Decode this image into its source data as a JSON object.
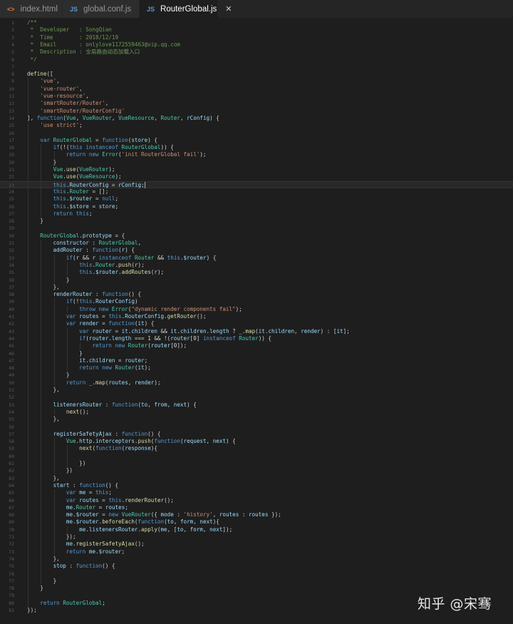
{
  "tabs": [
    {
      "label": "index.html",
      "icon": "html-file-icon",
      "active": false
    },
    {
      "label": "global.conf.js",
      "icon": "js-file-icon",
      "active": false
    },
    {
      "label": "RouterGlobal.js",
      "icon": "js-file-icon",
      "active": true
    }
  ],
  "tab_icons": {
    "html": "<>",
    "js": "JS"
  },
  "close_glyph": "✕",
  "cursor_line": 23,
  "code_lines": [
    "/**",
    " *  Developer   : SongQian",
    " *  Time        : 2018/12/19",
    " *  Email       : onlylove1172559463@vip.qq.com",
    " *  Description : 全局路由动态加载入口",
    " */",
    "",
    "define([",
    "    'vue',",
    "    'vue-router',",
    "    'vue-resource',",
    "    'smartRouter/Router',",
    "    'smartRouter/RouterConfig'",
    "], function(Vue, VueRouter, VueResource, Router, rConfig) {",
    "    'use strict';",
    "",
    "    var RouterGlobal = function(store) {",
    "        if(!(this instanceof RouterGlobal)) {",
    "            return new Error('init RouterGlobal fail');",
    "        }",
    "        Vue.use(VueRouter);",
    "        Vue.use(VueResource);",
    "        this.RouterConfig = rConfig;",
    "        this.Router = [];",
    "        this.$router = null;",
    "        this.$store = store;",
    "        return this;",
    "    }",
    "",
    "    RouterGlobal.prototype = {",
    "        constructor : RouterGlobal,",
    "        addRouter : function(r) {",
    "            if(r && r instanceof Router && this.$router) {",
    "                this.Router.push(r);",
    "                this.$router.addRoutes(r);",
    "            }",
    "        },",
    "        renderRouter : function() {",
    "            if(!this.RouterConfig)",
    "                throw new Error(\"dynamic render components fail\");",
    "            var routes = this.RouterConfig.getRouter();",
    "            var render = function(it) {",
    "                var router = it.children && it.children.length ? _.map(it.children, render) : [it];",
    "                if(router.length === 1 && !(router[0] instanceof Router)) {",
    "                    return new Router(router[0]);",
    "                }",
    "                it.children = router;",
    "                return new Router(it);",
    "            }",
    "            return _.map(routes, render);",
    "        },",
    "",
    "        listenersRouter : function(to, from, next) {",
    "            next();",
    "        },",
    "",
    "        registerSafetyAjax : function() {",
    "            Vue.http.interceptors.push(function(request, next) {",
    "                next(function(response){",
    "",
    "                })",
    "            })",
    "        },",
    "        start : function() {",
    "            var me = this;",
    "            var routes = this.renderRouter();",
    "            me.Router = routes;",
    "            me.$router = new VueRouter({ mode : 'history', routes : routes });",
    "            me.$router.beforeEach(function(to, form, next){",
    "                me.listenersRouter.apply(me, [to, form, next]);",
    "            });",
    "            me.registerSafetyAjax();",
    "            return me.$router;",
    "        },",
    "        stop : function() {",
    "",
    "        }",
    "    }",
    "",
    "    return RouterGlobal;",
    "});"
  ],
  "watermark": "知乎 @宋骞"
}
